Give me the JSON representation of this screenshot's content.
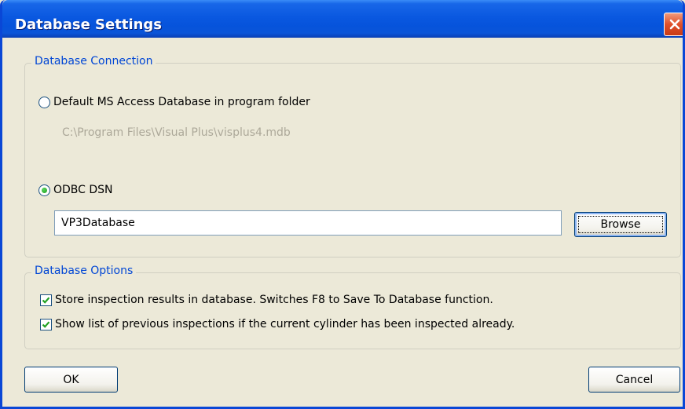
{
  "window": {
    "title": "Database Settings"
  },
  "connection": {
    "legend": "Database Connection",
    "default_option": {
      "label": "Default MS Access Database in program folder",
      "selected": false
    },
    "default_path": "C:\\Program Files\\Visual Plus\\visplus4.mdb",
    "odbc_option": {
      "label": "ODBC DSN",
      "selected": true
    },
    "dsn_value": "VP3Database",
    "browse_label": "Browse"
  },
  "options": {
    "legend": "Database Options",
    "store_results": {
      "label": "Store inspection results in database. Switches F8 to Save To Database function.",
      "checked": true
    },
    "show_previous": {
      "label": "Show list of previous inspections if the current cylinder has been inspected already.",
      "checked": true
    }
  },
  "footer": {
    "ok_label": "OK",
    "cancel_label": "Cancel"
  },
  "colors": {
    "accent": "#0046d5",
    "title_bar": "#0a58e0",
    "check_mark": "#21a121"
  }
}
